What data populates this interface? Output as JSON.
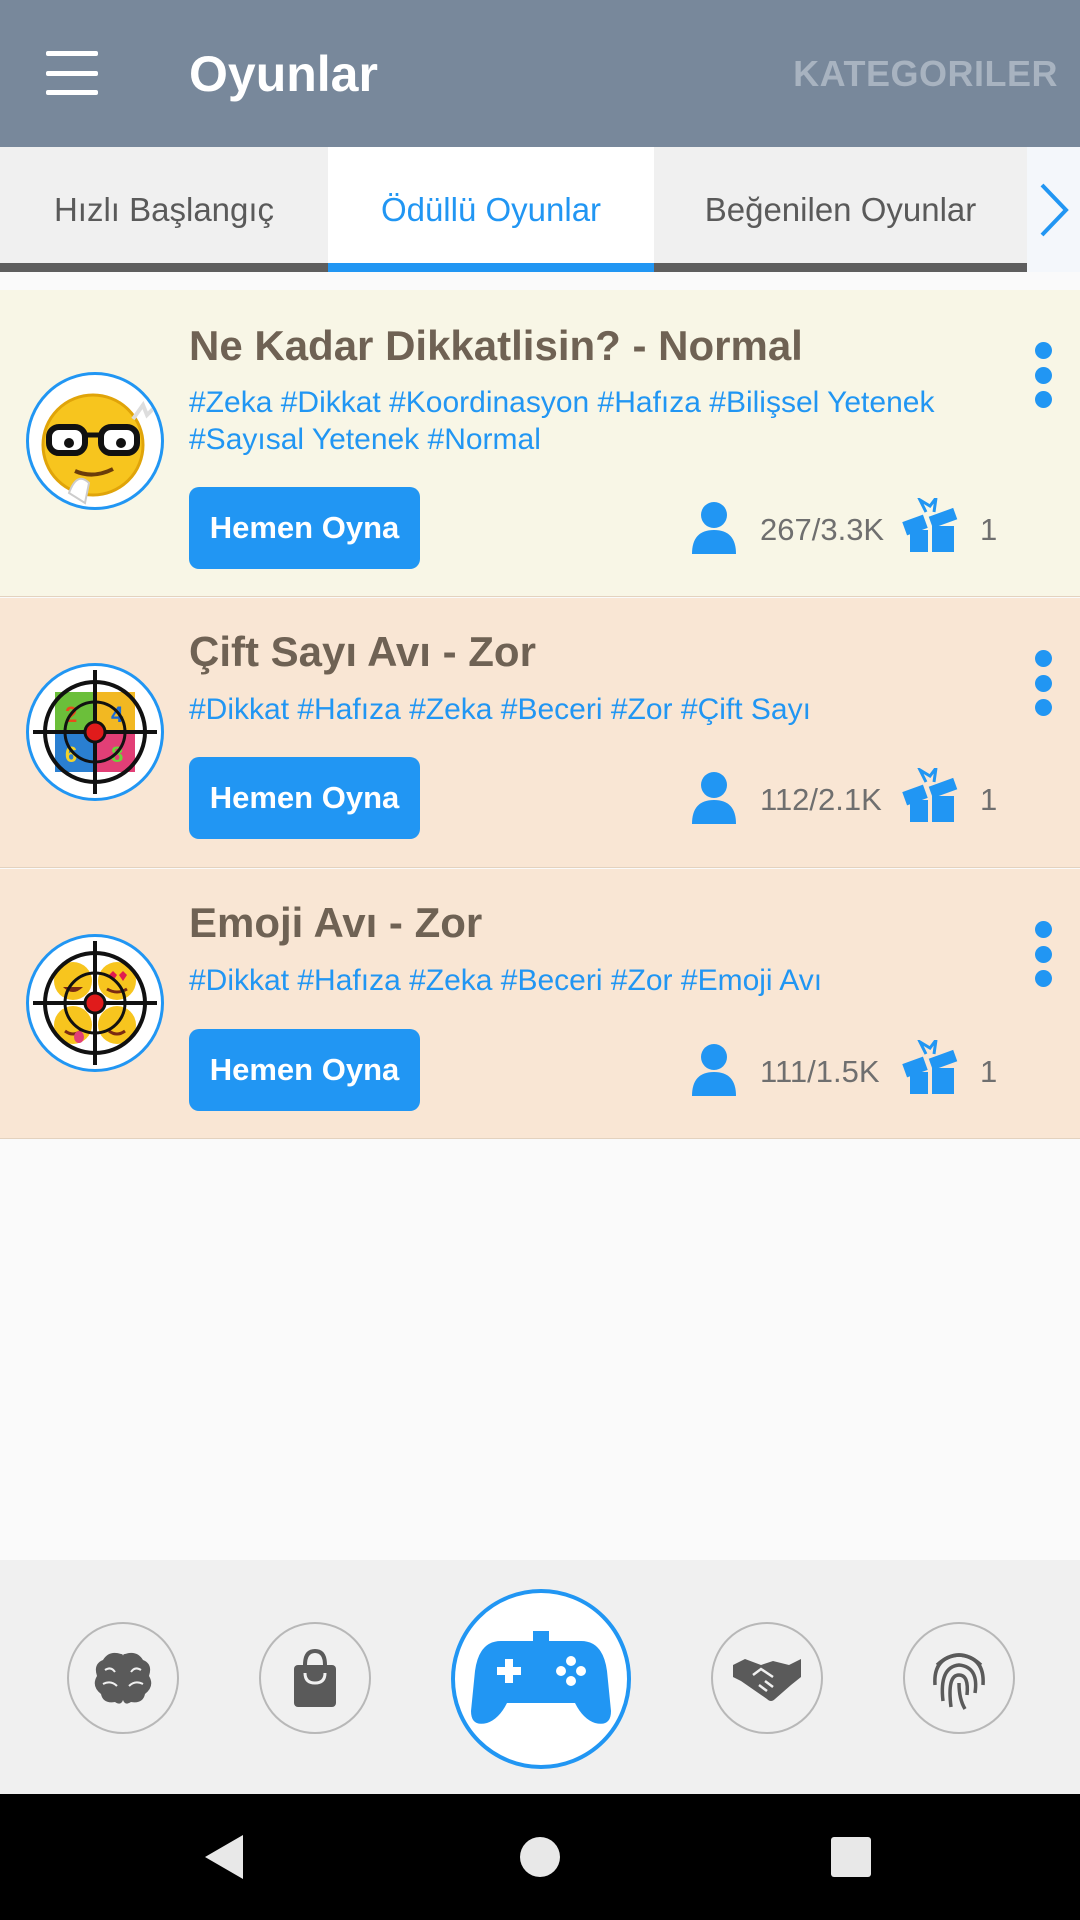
{
  "appbar": {
    "title": "Oyunlar",
    "categories_label": "KATEGORILER"
  },
  "tabs": [
    {
      "label": "Hızlı Başlangıç",
      "active": false
    },
    {
      "label": "Ödüllü Oyunlar",
      "active": true
    },
    {
      "label": "Beğenilen Oyunlar",
      "active": false
    }
  ],
  "games": [
    {
      "title": "Ne Kadar Dikkatlisin? - Normal",
      "tags": "#Zeka #Dikkat #Koordinasyon #Hafıza #Bilişsel Yetenek #Sayısal Yetenek #Normal",
      "play_label": "Hemen Oyna",
      "players": "267/3.3K",
      "rewards": "1",
      "icon": "smiley-glasses-icon"
    },
    {
      "title": "Çift Sayı Avı - Zor",
      "tags": "#Dikkat #Hafıza #Zeka #Beceri #Zor #Çift Sayı",
      "play_label": "Hemen Oyna",
      "players": "112/2.1K",
      "rewards": "1",
      "icon": "crosshair-numbers-icon"
    },
    {
      "title": "Emoji Avı - Zor",
      "tags": "#Dikkat #Hafıza #Zeka #Beceri #Zor #Emoji Avı",
      "play_label": "Hemen Oyna",
      "players": "111/1.5K",
      "rewards": "1",
      "icon": "crosshair-emoji-icon"
    }
  ],
  "bottom_nav": [
    "brain-icon",
    "shopping-bag-icon",
    "gamepad-icon",
    "handshake-icon",
    "fingerprint-icon"
  ],
  "colors": {
    "accent": "#2196f3",
    "appbar": "#78889b",
    "card_yellow": "#f8f6e6",
    "card_peach": "#f9e6d4"
  }
}
